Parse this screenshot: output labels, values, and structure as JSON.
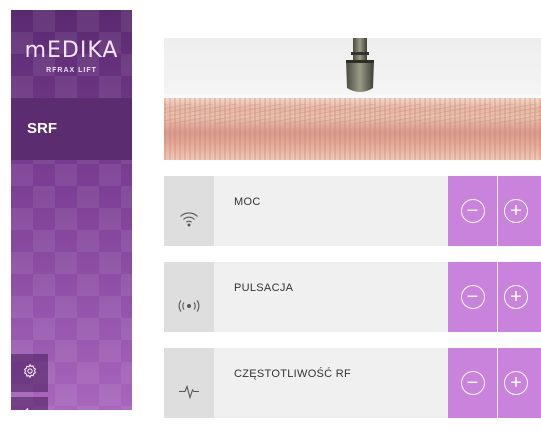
{
  "sidebar": {
    "logo_main": "mEDIKA",
    "logo_sub": "RFRAX LIFT",
    "nav_item": "SRF",
    "settings_icon": "gear-icon",
    "back_icon": "arrow-left-icon"
  },
  "hero": {
    "image": "rf-probe-on-skin-illustration"
  },
  "controls": [
    {
      "label": "MOC",
      "icon": "wifi-icon",
      "minus": "−",
      "plus": "+"
    },
    {
      "label": "PULSACJA",
      "icon": "pulse-signal-icon",
      "minus": "−",
      "plus": "+"
    },
    {
      "label": "CZĘSTOTLIWOŚĆ RF",
      "icon": "heartbeat-icon",
      "minus": "−",
      "plus": "+"
    }
  ],
  "colors": {
    "accent": "#c983dc",
    "sidebar": "#8f4fa5",
    "sidebar_active": "#5b2c70"
  }
}
